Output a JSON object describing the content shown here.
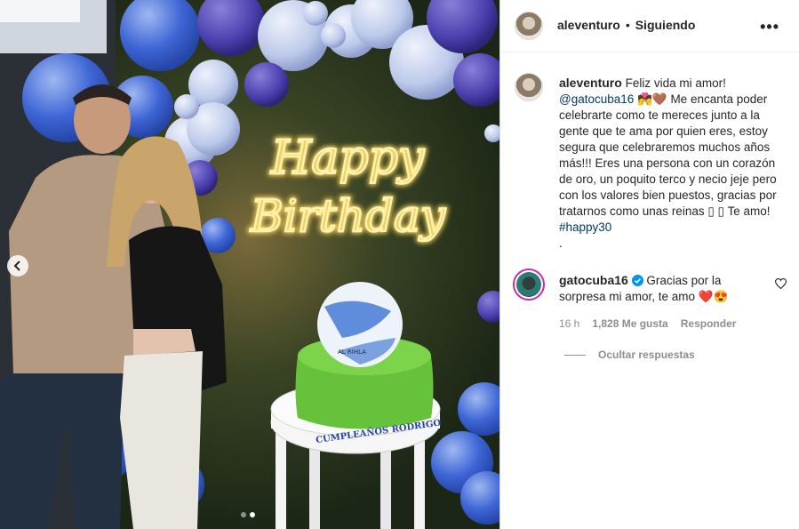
{
  "post": {
    "username": "aleventuro",
    "separator": "•",
    "follow_status": "Siguiendo",
    "more_icon": "more-options-icon",
    "caption": {
      "username": "aleventuro",
      "line_start": "Feliz vida mi amor!",
      "mention": "@gatocuba16",
      "emojis": "💏🤎",
      "body": "Me encanta poder celebrarte como te mereces junto a la gente que te ama por quien eres, estoy segura que celebraremos muchos años más!!! Eres una persona con un corazón de oro, un poquito terco y necio jeje pero con los valores bien puestos, gracias por tratarnos como unas reinas ▯ ▯ Te amo!",
      "hashtag": "#happy30",
      "trailing": "."
    },
    "reply": {
      "username": "gatocuba16",
      "verified_icon": "verified-badge-icon",
      "text": "Gracias por la sorpresa mi amor, te amo",
      "emojis": "❤️😍",
      "time": "16 h",
      "likes": "1,828 Me gusta",
      "reply_label": "Responder",
      "hide_replies": "Ocultar respuestas"
    },
    "photo": {
      "neon_line1": "Happy",
      "neon_line2": "Birthday",
      "cake_text": "CUMPLEAÑOS RODRIGO",
      "ball_text": "AL RIHLA",
      "carousel": {
        "total": 2,
        "active": 2
      }
    },
    "colors": {
      "link": "#00376b",
      "muted": "#8e8e8e",
      "neon": "#fff3b0",
      "verified": "#0095f6"
    }
  }
}
